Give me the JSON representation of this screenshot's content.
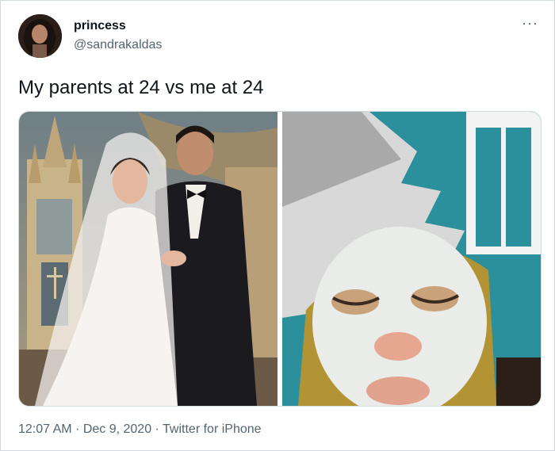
{
  "tweet": {
    "display_name": "princess",
    "handle": "@sandrakaldas",
    "text": "My parents at 24 vs me at 24",
    "more_icon": "ellipsis-icon",
    "timestamp": "12:07 AM · Dec 9, 2020 · Twitter for iPhone"
  },
  "media": {
    "photos": [
      {
        "subject": "wedding-photo"
      },
      {
        "subject": "face-mask-selfie"
      }
    ]
  }
}
